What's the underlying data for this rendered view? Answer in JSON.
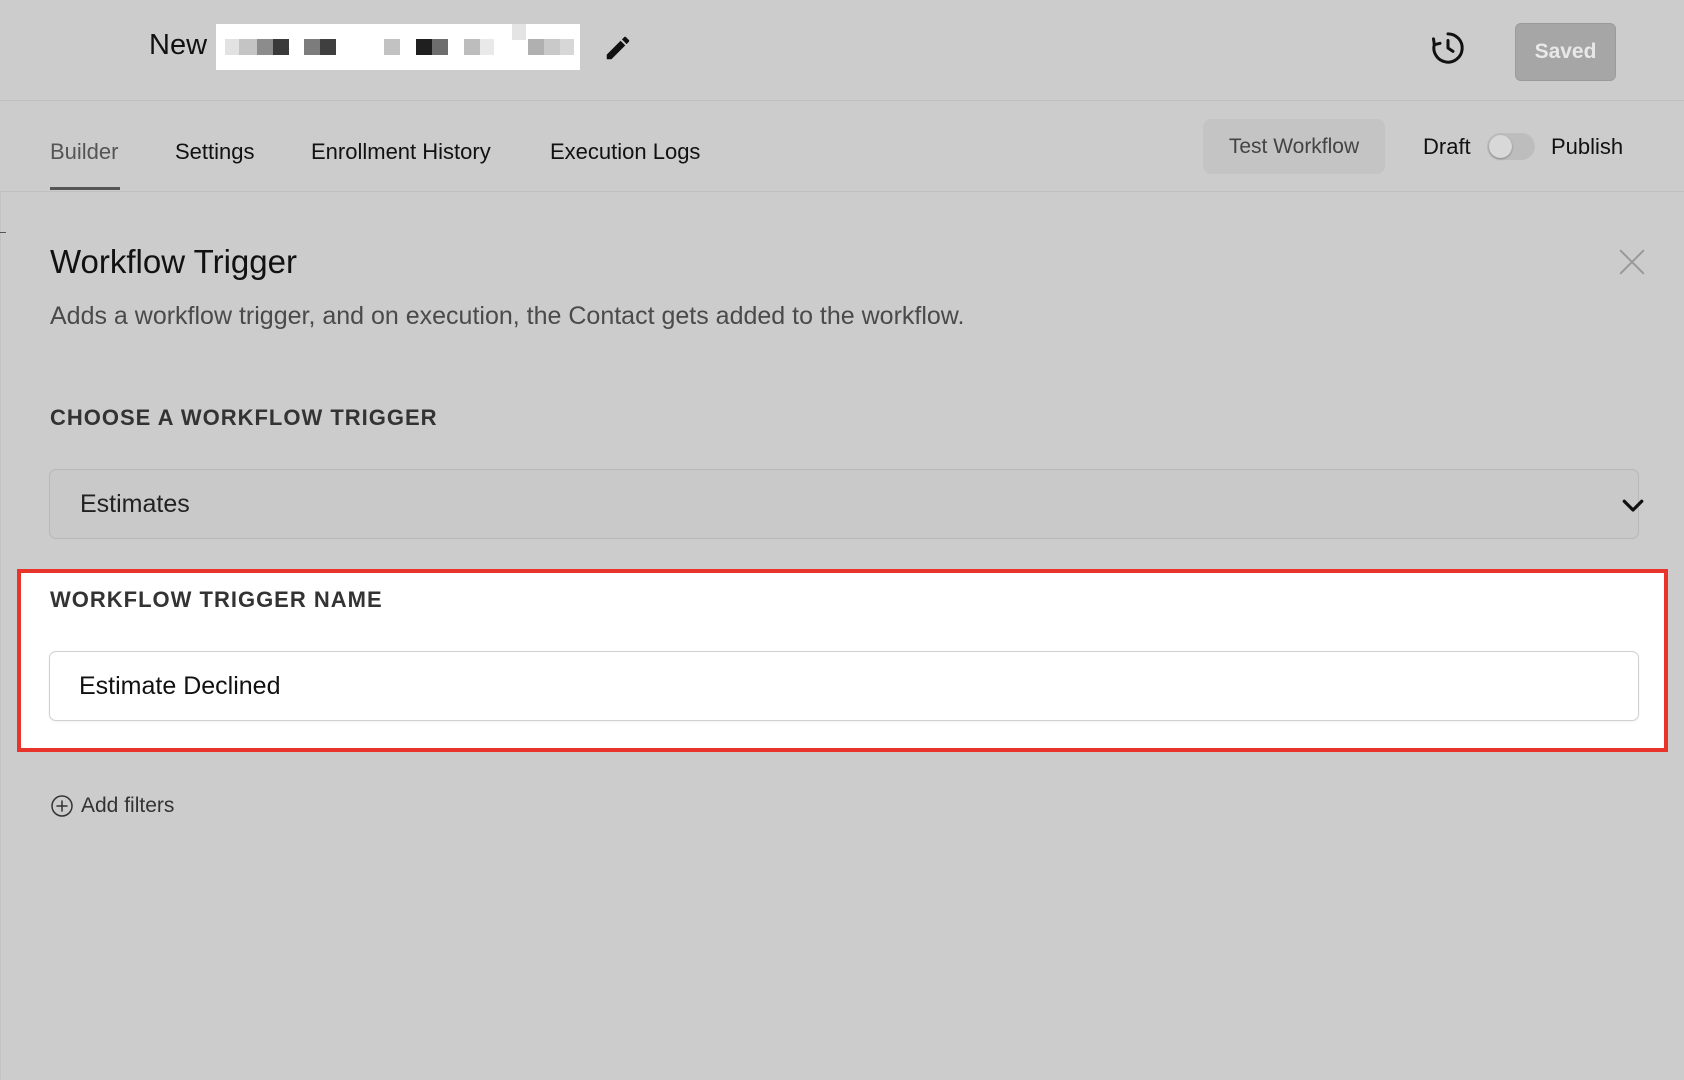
{
  "header": {
    "workflow_title": "New",
    "saved_label": "Saved"
  },
  "tabs": [
    {
      "label": "Builder",
      "active": true
    },
    {
      "label": "Settings",
      "active": false
    },
    {
      "label": "Enrollment History",
      "active": false
    },
    {
      "label": "Execution Logs",
      "active": false
    }
  ],
  "toolbar": {
    "test_label": "Test Workflow",
    "draft_label": "Draft",
    "publish_label": "Publish",
    "publish_toggle_on": false
  },
  "panel": {
    "title": "Workflow Trigger",
    "description": "Adds a workflow trigger, and on execution, the Contact gets added to the workflow.",
    "choose_label": "CHOOSE A WORKFLOW TRIGGER",
    "selected_trigger": "Estimates",
    "name_label": "WORKFLOW TRIGGER NAME",
    "name_value": "Estimate Declined",
    "add_filters_label": "Add filters"
  },
  "colors": {
    "background": "#cccccc",
    "highlight_border": "#e8342a",
    "saved_button": "#a6a6a6"
  },
  "icons": [
    "edit-icon",
    "history-icon",
    "close-icon",
    "chevron-down-icon",
    "plus-circle-icon"
  ]
}
